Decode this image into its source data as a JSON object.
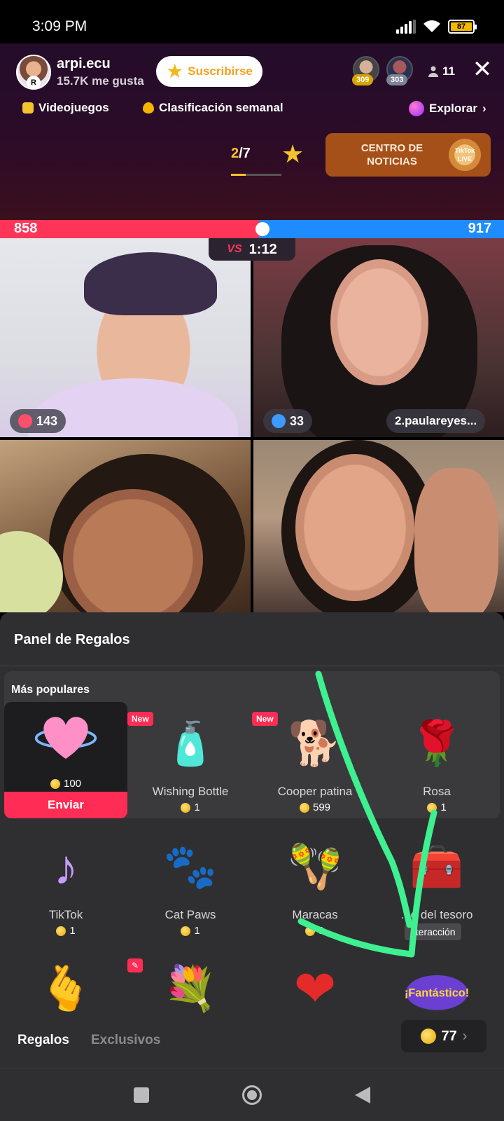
{
  "status_bar": {
    "time": "3:09 PM",
    "battery": "87"
  },
  "header": {
    "host_name": "arpi.ecu",
    "host_likes": "15.7K me gusta",
    "subscribe_label": "Suscribirse",
    "top_viewers": [
      {
        "rank": "309"
      },
      {
        "rank": "303"
      }
    ],
    "viewer_count": "11",
    "chips": {
      "category": "Videojuegos",
      "ranking": "Clasificación semanal",
      "explore": "Explorar"
    },
    "page_indicator": {
      "current": "2",
      "total": "/7",
      "progress": 0.2857
    },
    "news_title": "CENTRO DE NOTICIAS",
    "news_logo_text": "TikTok LIVE"
  },
  "battle": {
    "score_left": "858",
    "score_right": "917",
    "vs_label": "VS",
    "timer": "1:12"
  },
  "videos": {
    "v1_count": "143",
    "v2_count": "33",
    "v2_name": "2.paulareyes..."
  },
  "gift_panel": {
    "title": "Panel de Regalos",
    "popular_label": "Más populares",
    "selected": {
      "price": "100",
      "send_label": "Enviar"
    },
    "new_badge": "New",
    "gifts": [
      {
        "name": "Wishing Bottle",
        "price": "1"
      },
      {
        "name": "Cooper patina",
        "price": "599"
      },
      {
        "name": "Rosa",
        "price": "1"
      },
      {
        "name": "TikTok",
        "price": "1"
      },
      {
        "name": "Cat Paws",
        "price": "1"
      },
      {
        "name": "Maracas",
        "price": "1"
      },
      {
        "name": "...e del tesoro",
        "tag": "nteracción"
      }
    ],
    "tabs": {
      "gifts": "Regalos",
      "exclusives": "Exclusivos"
    },
    "coin_balance": "77",
    "fantastico_text": "¡Fantástico!"
  },
  "colors": {
    "score_red": "#ff3558",
    "score_blue": "#1e8cff",
    "send": "#ff2d55",
    "accent_gold": "#f5c230",
    "annotation": "#3ef08f"
  }
}
